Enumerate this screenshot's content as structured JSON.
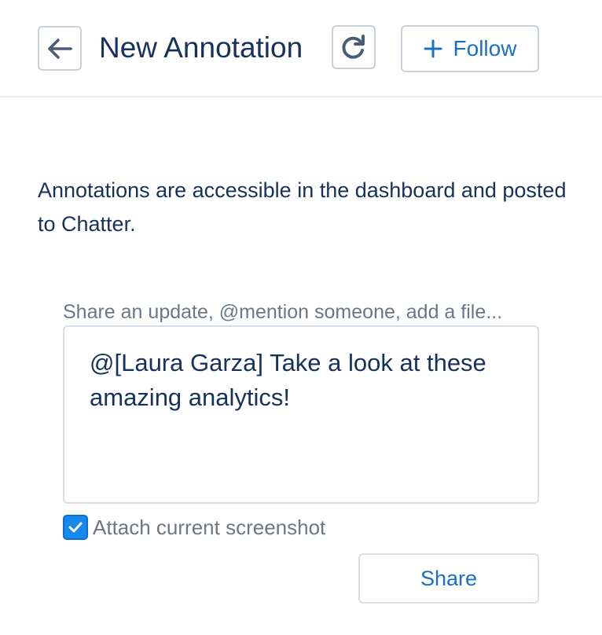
{
  "header": {
    "title": "New Annotation",
    "back_icon": "arrow-left-icon",
    "refresh_icon": "refresh-icon",
    "follow": {
      "icon": "plus-icon",
      "label": "Follow"
    }
  },
  "main": {
    "description": "Annotations are accessible in the dashboard and posted to Chatter.",
    "composer": {
      "placeholder": "Share an update, @mention someone, add a file...",
      "value": "@[Laura Garza] Take a look at these amazing analytics!"
    },
    "attach": {
      "checked": true,
      "label": "Attach current screenshot"
    },
    "share_label": "Share"
  },
  "colors": {
    "text": "#16325c",
    "accent": "#1b6fc7",
    "checkbox": "#1589ee",
    "border": "#c9d1db",
    "muted_text": "#6b7785"
  }
}
